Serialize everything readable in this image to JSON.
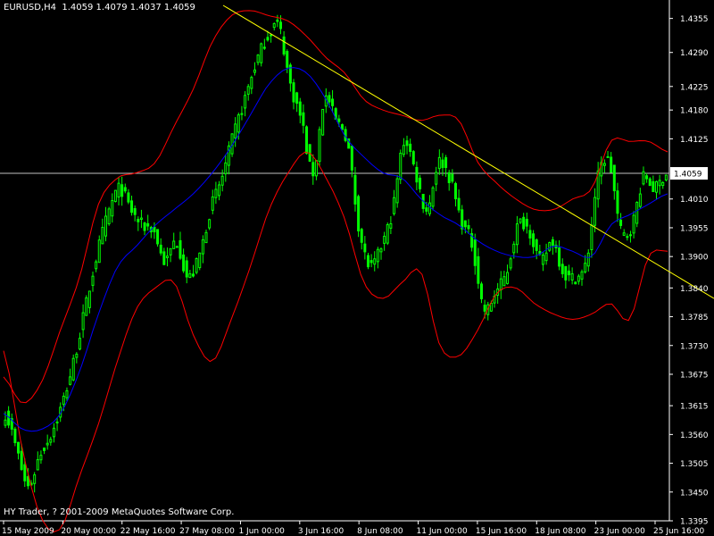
{
  "header": {
    "symbol": "EURUSD",
    "timeframe": "H4",
    "ohlc_text": "1.4059 1.4079 1.4037 1.4059"
  },
  "footer": {
    "copyright": "HY Trader, ? 2001-2009 MetaQuotes Software Corp."
  },
  "colors": {
    "background": "#000000",
    "bull_candle": "#00ff00",
    "moving_average": "#0000ff",
    "bollinger_bands": "#ff0000",
    "trend_line": "#ffff00",
    "price_line": "#c0c0c0",
    "axis_text": "#ffffff"
  },
  "chart_data": {
    "type": "candlestick",
    "indicators": [
      "bollinger bands",
      "moving average"
    ],
    "current_price": "1.4059",
    "ylim": [
      1.3395,
      1.438
    ],
    "y_ticks": [
      "1.4355",
      "1.4290",
      "1.4225",
      "1.4180",
      "1.4125",
      "1.4059",
      "1.4010",
      "1.3955",
      "1.3900",
      "1.3840",
      "1.3785",
      "1.3730",
      "1.3675",
      "1.3615",
      "1.3560",
      "1.3505",
      "1.3450",
      "1.3395"
    ],
    "x_ticks": [
      "15 May 2009",
      "20 May 00:00",
      "22 May 16:00",
      "27 May 08:00",
      "1 Jun 00:00",
      "3 Jun 16:00",
      "8 Jun 08:00",
      "11 Jun 00:00",
      "15 Jun 16:00",
      "18 Jun 08:00",
      "23 Jun 00:00",
      "25 Jun 16:00"
    ],
    "close_series": [
      1.36,
      1.353,
      1.346,
      1.352,
      1.356,
      1.362,
      1.37,
      1.38,
      1.39,
      1.398,
      1.403,
      1.399,
      1.396,
      1.395,
      1.389,
      1.393,
      1.386,
      1.39,
      1.399,
      1.405,
      1.413,
      1.42,
      1.427,
      1.432,
      1.434,
      1.423,
      1.416,
      1.406,
      1.42,
      1.416,
      1.412,
      1.396,
      1.388,
      1.392,
      1.399,
      1.412,
      1.406,
      1.399,
      1.408,
      1.405,
      1.397,
      1.392,
      1.38,
      1.383,
      1.387,
      1.396,
      1.395,
      1.389,
      1.393,
      1.387,
      1.386,
      1.389,
      1.405,
      1.408,
      1.395,
      1.396,
      1.405,
      1.403,
      1.406
    ],
    "ma_series": [
      1.36,
      1.357,
      1.357,
      1.36,
      1.368,
      1.379,
      1.388,
      1.392,
      1.396,
      1.399,
      1.402,
      1.406,
      1.411,
      1.417,
      1.423,
      1.426,
      1.425,
      1.42,
      1.413,
      1.409,
      1.406,
      1.405,
      1.401,
      1.398,
      1.396,
      1.393,
      1.391,
      1.39,
      1.39,
      1.392,
      1.391,
      1.39,
      1.396,
      1.398,
      1.4,
      1.402
    ],
    "upper_band": [
      1.367,
      1.362,
      1.366,
      1.376,
      1.386,
      1.4,
      1.405,
      1.406,
      1.408,
      1.415,
      1.422,
      1.431,
      1.436,
      1.437,
      1.436,
      1.435,
      1.432,
      1.428,
      1.425,
      1.42,
      1.418,
      1.417,
      1.416,
      1.417,
      1.416,
      1.408,
      1.404,
      1.401,
      1.399,
      1.399,
      1.401,
      1.403,
      1.412,
      1.412,
      1.412,
      1.41
    ],
    "lower_band": [
      1.372,
      1.353,
      1.34,
      1.338,
      1.348,
      1.358,
      1.37,
      1.38,
      1.384,
      1.385,
      1.375,
      1.37,
      1.378,
      1.388,
      1.399,
      1.406,
      1.41,
      1.405,
      1.397,
      1.385,
      1.382,
      1.385,
      1.387,
      1.373,
      1.371,
      1.376,
      1.383,
      1.384,
      1.381,
      1.379,
      1.378,
      1.379,
      1.381,
      1.378,
      1.39,
      1.391
    ],
    "trend_line": {
      "start_price": 1.438,
      "end_price": 1.382
    },
    "grid": false
  }
}
